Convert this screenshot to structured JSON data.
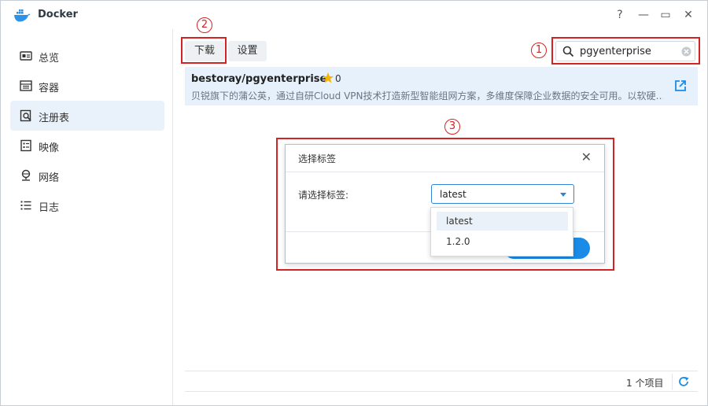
{
  "app": {
    "title": "Docker"
  },
  "window_controls": {
    "help": "?",
    "minimize": "—",
    "maximize": "▭",
    "close": "✕"
  },
  "sidebar": {
    "items": [
      {
        "label": "总览",
        "icon": "overview-icon",
        "active": false
      },
      {
        "label": "容器",
        "icon": "container-icon",
        "active": false
      },
      {
        "label": "注册表",
        "icon": "registry-icon",
        "active": true
      },
      {
        "label": "映像",
        "icon": "image-icon",
        "active": false
      },
      {
        "label": "网络",
        "icon": "network-icon",
        "active": false
      },
      {
        "label": "日志",
        "icon": "log-icon",
        "active": false
      }
    ]
  },
  "toolbar": {
    "download_label": "下载",
    "settings_label": "设置"
  },
  "search": {
    "value": "pgyenterprise"
  },
  "annotations": {
    "m1": "1",
    "m2": "2",
    "m3": "3"
  },
  "result": {
    "name": "bestoray/pgyenterprise",
    "stars": "0",
    "description": "贝锐旗下的蒲公英，通过自研Cloud VPN技术打造新型智能组网方案，多维度保障企业数据的安全可用。以软硬…"
  },
  "dialog": {
    "title": "选择标签",
    "field_label": "请选择标签:",
    "selected": "latest",
    "options": [
      "latest",
      "1.2.0"
    ]
  },
  "footer": {
    "count": "1 个项目"
  },
  "colors": {
    "accent": "#1a8ce8",
    "highlight": "#d42323",
    "selected_row": "#e6f1fb"
  }
}
